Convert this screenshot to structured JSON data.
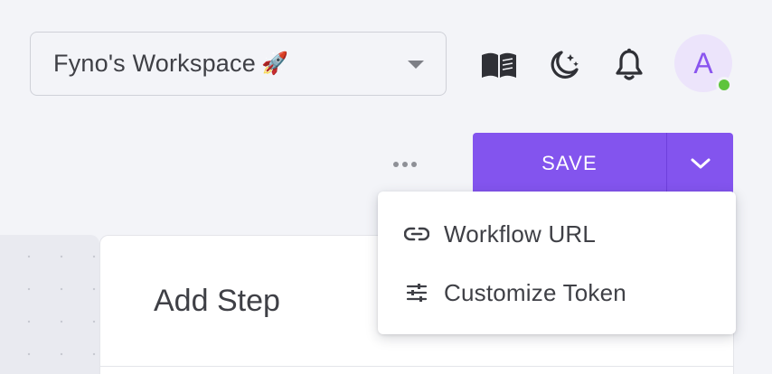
{
  "header": {
    "workspace_name": "Fyno's Workspace",
    "workspace_emoji": "🚀",
    "icons": [
      "book-icon",
      "moon-stars-icon",
      "bell-icon"
    ],
    "avatar_initial": "A",
    "avatar_status": "online"
  },
  "toolbar": {
    "more_label": "more-horizontal-icon",
    "save_label": "SAVE",
    "save_toggle_icon": "chevron-down-icon"
  },
  "dropdown_menu": {
    "items": [
      {
        "label": "Workflow URL",
        "icon": "link-icon"
      },
      {
        "label": "Customize Token",
        "icon": "sliders-icon"
      }
    ]
  },
  "main": {
    "card_title": "Add Step"
  },
  "colors": {
    "accent": "#8354ee",
    "background": "#f3f4f8",
    "avatar_bg": "#ece4fb",
    "online": "#5ec43c",
    "text": "#3f4046"
  }
}
